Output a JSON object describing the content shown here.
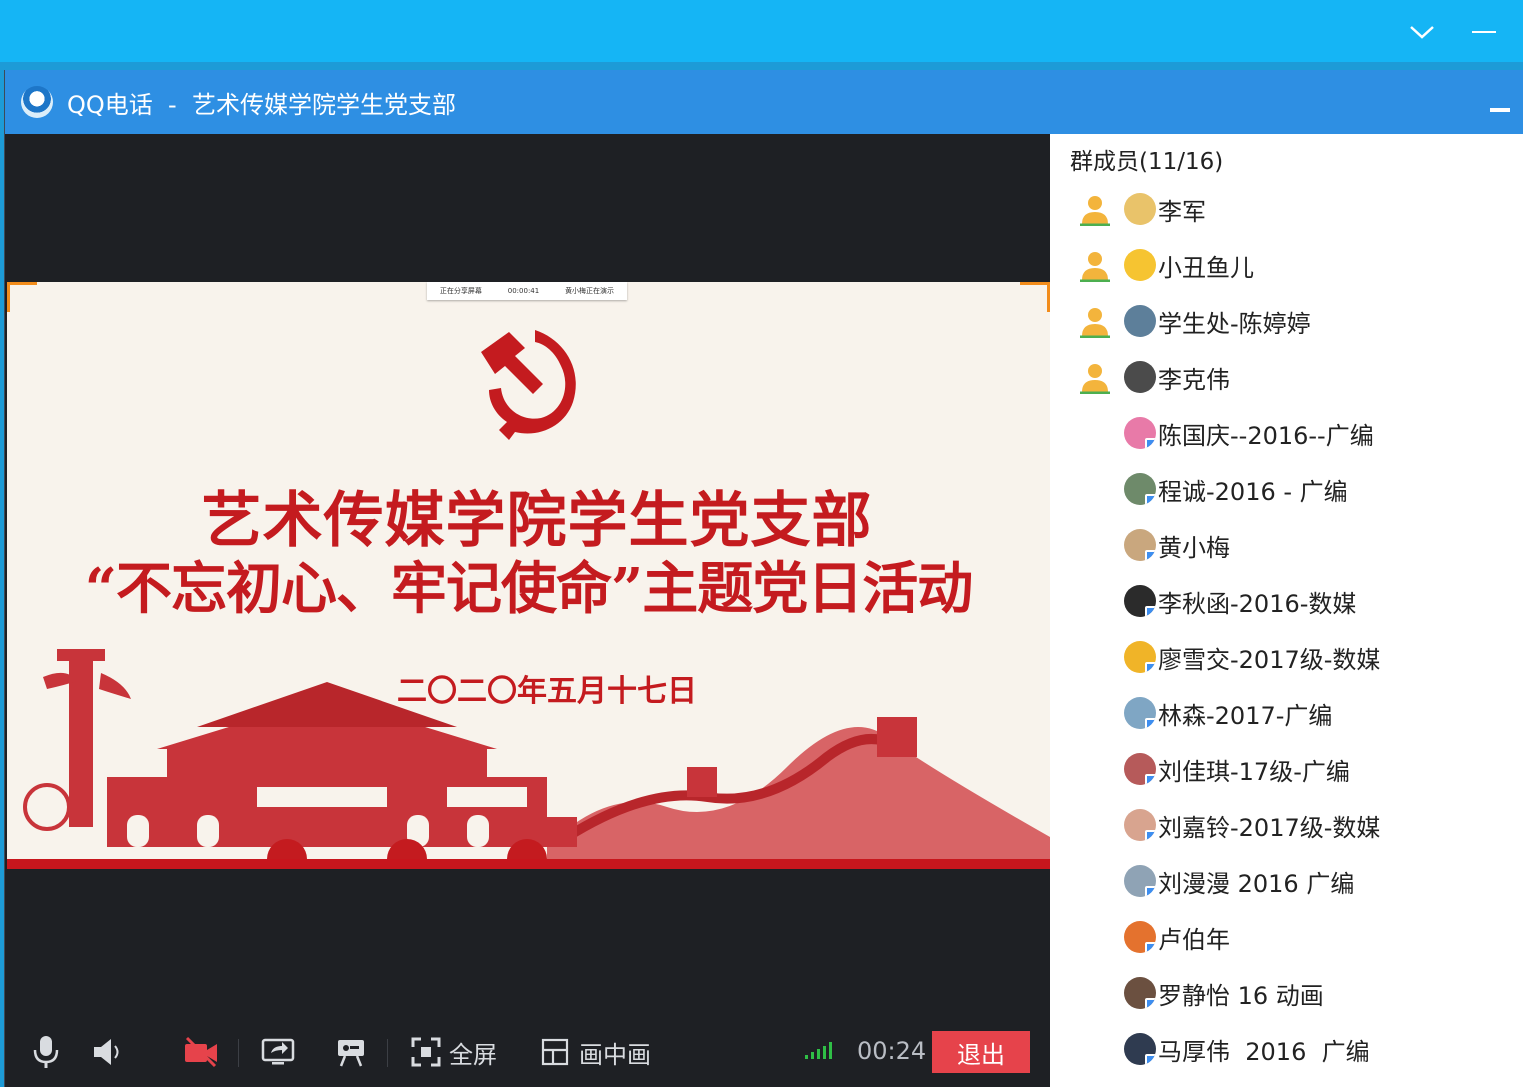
{
  "window_title": "QQ电话  -  艺术传媒学院学生党支部",
  "slide": {
    "share_status": [
      "正在分享屏幕",
      "00:00:41",
      "黄小梅正在演示"
    ],
    "title_line1": "艺术传媒学院学生党支部",
    "title_line2": "“不忘初心、牢记使命”主题党日活动",
    "date": "二〇二〇年五月十七日"
  },
  "toolbar": {
    "fullscreen_label": "全屏",
    "pip_label": "画中画",
    "timer": "00:24",
    "exit_label": "退出"
  },
  "members": {
    "header": "群成员(11/16)",
    "list": [
      {
        "name": "李军",
        "speaking": true,
        "color": "#e9c36a"
      },
      {
        "name": "小丑鱼儿",
        "speaking": true,
        "color": "#f6c431"
      },
      {
        "name": "学生处-陈婷婷",
        "speaking": true,
        "color": "#5d7f9a"
      },
      {
        "name": "李克伟",
        "speaking": true,
        "color": "#4b4b4b"
      },
      {
        "name": "陈国庆--2016--广编",
        "speaking": false,
        "color": "#e87aa8"
      },
      {
        "name": "程诚-2016 - 广编",
        "speaking": false,
        "color": "#6e8a6a"
      },
      {
        "name": "黄小梅",
        "speaking": false,
        "color": "#c9a77e"
      },
      {
        "name": "李秋函-2016-数媒",
        "speaking": false,
        "color": "#2b2b2b"
      },
      {
        "name": "廖雪交-2017级-数媒",
        "speaking": false,
        "color": "#f0b428"
      },
      {
        "name": "林森-2017-广编",
        "speaking": false,
        "color": "#7fa6c4"
      },
      {
        "name": "刘佳琪-17级-广编",
        "speaking": false,
        "color": "#b65a5a"
      },
      {
        "name": "刘嘉铃-2017级-数媒",
        "speaking": false,
        "color": "#d8a48f"
      },
      {
        "name": "刘漫漫 2016 广编",
        "speaking": false,
        "color": "#8fa3b5"
      },
      {
        "name": "卢伯年",
        "speaking": false,
        "color": "#e4722e"
      },
      {
        "name": "罗静怡 16 动画",
        "speaking": false,
        "color": "#6b5040"
      },
      {
        "name": "马厚伟  2016  广编",
        "speaking": false,
        "color": "#2f3b50"
      }
    ]
  }
}
